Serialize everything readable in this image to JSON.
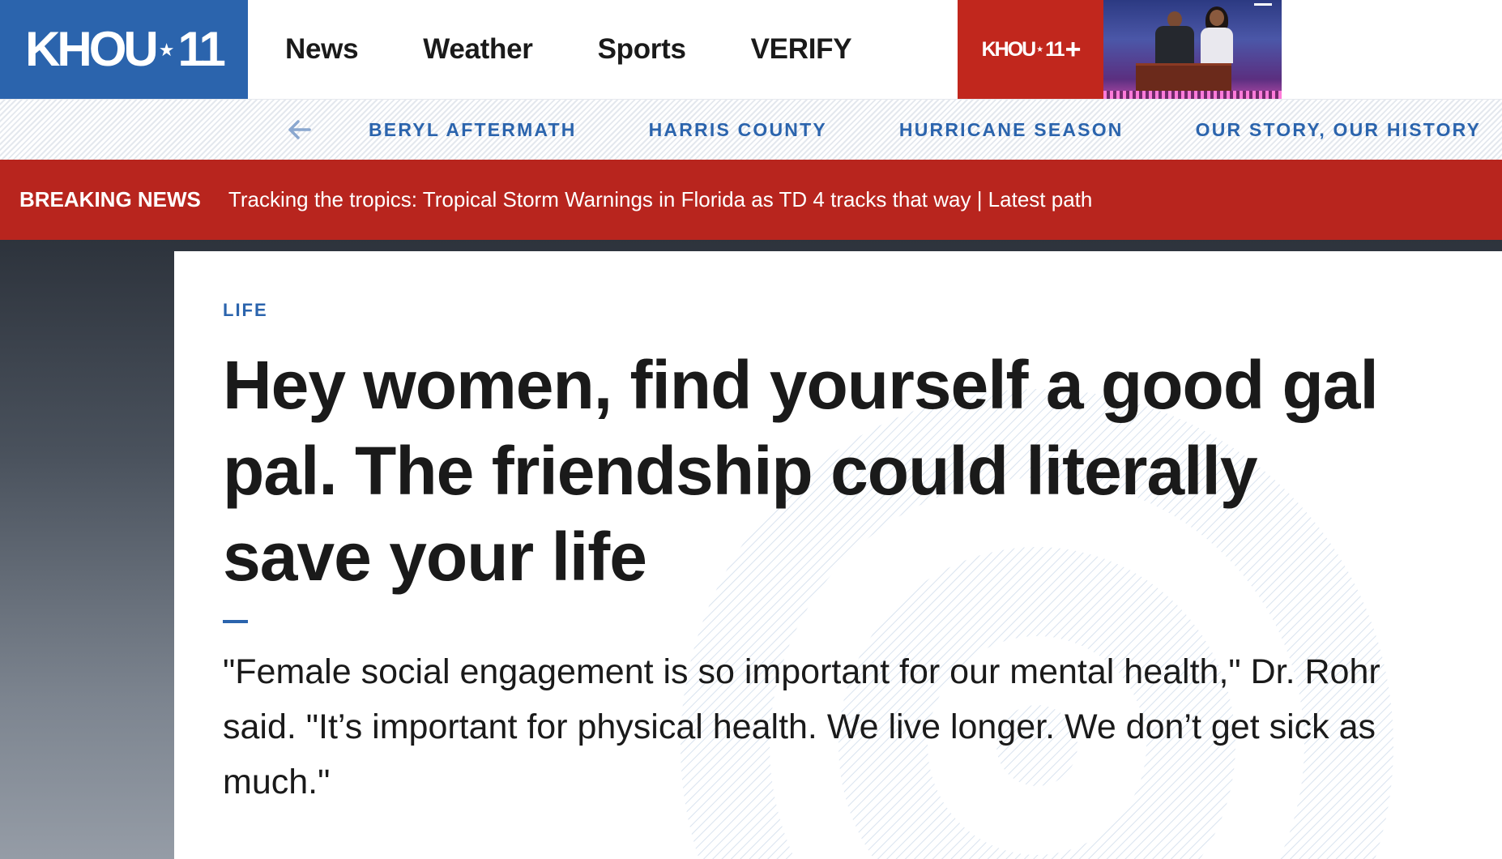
{
  "header": {
    "logo_text": "KHOU",
    "logo_number": "11",
    "nav": [
      "News",
      "Weather",
      "Sports",
      "VERIFY"
    ],
    "plus_logo_text": "KHOU",
    "plus_logo_number": "11",
    "plus_sign": "+",
    "colors": {
      "brand_blue": "#2b64ad",
      "plus_red": "#c1271d"
    }
  },
  "subnav": {
    "back_icon": "arrow-left-icon",
    "links": [
      "BERYL AFTERMATH",
      "HARRIS COUNTY",
      "HURRICANE SEASON",
      "OUR STORY, OUR HISTORY"
    ]
  },
  "breaking": {
    "label": "BREAKING NEWS",
    "text": "Tracking the tropics: Tropical Storm Warnings in Florida as TD 4 tracks that way | Latest path",
    "color": "#b8251e"
  },
  "article": {
    "category": "LIFE",
    "headline": "Hey women, find yourself a good gal pal. The friendship could literally save your life",
    "summary": "\"Female social engagement is so important for our mental health,\" Dr. Rohr said. \"It’s important for physical health. We live longer. We don’t get sick as much.\""
  }
}
